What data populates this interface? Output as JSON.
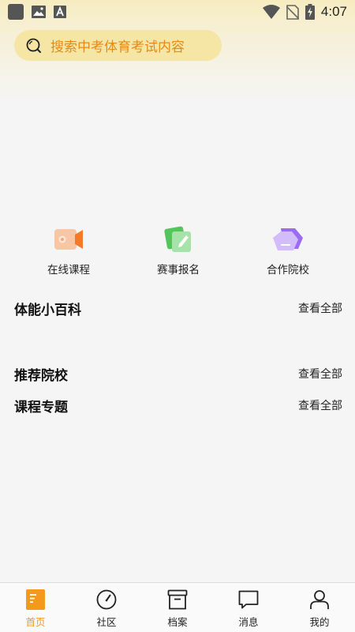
{
  "status_bar": {
    "time": "4:07"
  },
  "search": {
    "placeholder": "搜索中考体育考试内容"
  },
  "quick_actions": [
    {
      "label": "在线课程",
      "icon": "video-camera-icon"
    },
    {
      "label": "赛事报名",
      "icon": "edit-card-icon"
    },
    {
      "label": "合作院校",
      "icon": "school-building-icon"
    }
  ],
  "sections": [
    {
      "title": "体能小百科",
      "more": "查看全部"
    },
    {
      "title": "推荐院校",
      "more": "查看全部"
    },
    {
      "title": "课程专题",
      "more": "查看全部"
    }
  ],
  "tabs": [
    {
      "label": "首页",
      "icon": "home-doc-icon",
      "active": true
    },
    {
      "label": "社区",
      "icon": "compass-icon",
      "active": false
    },
    {
      "label": "档案",
      "icon": "archive-box-icon",
      "active": false
    },
    {
      "label": "消息",
      "icon": "message-icon",
      "active": false
    },
    {
      "label": "我的",
      "icon": "person-icon",
      "active": false
    }
  ],
  "colors": {
    "accent": "#f39a1e",
    "search_bg": "#f6e6a6",
    "search_text": "#e58a17"
  }
}
